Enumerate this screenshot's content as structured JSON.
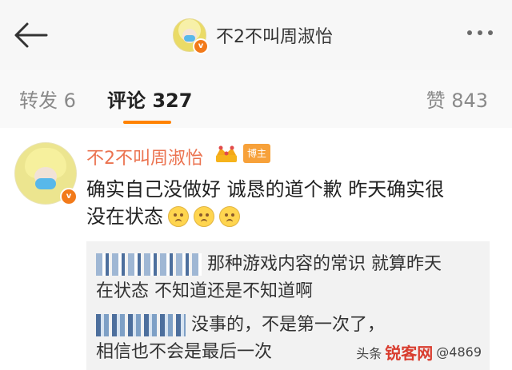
{
  "header": {
    "title": "不2不叫周淑怡"
  },
  "tabs": {
    "repost": "转发 6",
    "comment": "评论 327",
    "like": "赞 843"
  },
  "comment": {
    "username": "不2不叫周淑怡",
    "tag": "博主",
    "text_line1": "确实自己没做好 诚恳的道个歉 昨天确实很",
    "text_line2": "没在状态",
    "quote": {
      "reply1_line1": "那种游戏内容的常识  就算昨天",
      "reply1_line2": "在状态  不知道还是不知道啊",
      "reply2_line1": "没事的，不是第一次了，",
      "reply2_line2": "相信也不会是最后一次"
    }
  },
  "watermark": {
    "platform": "头条",
    "brand": "锐客网",
    "handle": "@4869"
  },
  "colors": {
    "accent": "#ff8200",
    "username": "#eb7350",
    "badge": "#f27a1a"
  },
  "icons": [
    "back-arrow-icon",
    "more-icon",
    "crown-icon",
    "verified-badge-icon"
  ]
}
